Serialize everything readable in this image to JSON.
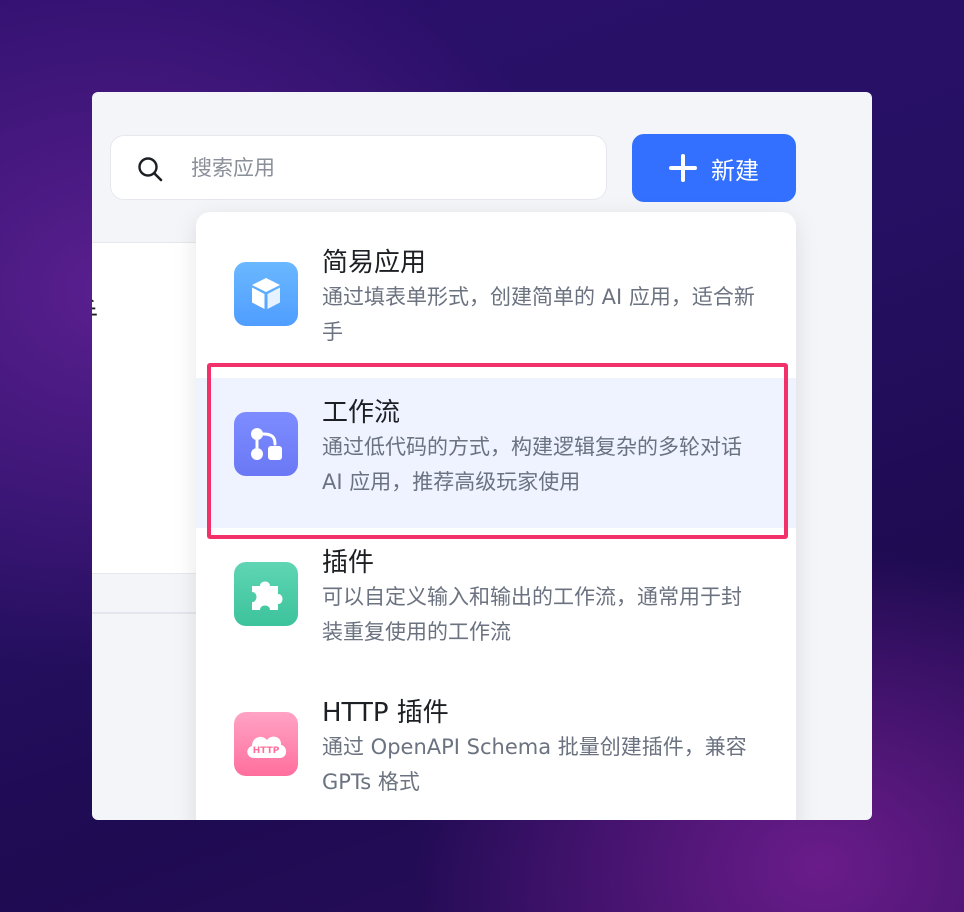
{
  "search": {
    "placeholder": "搜索应用"
  },
  "toolbar": {
    "new_label": "新建"
  },
  "background_card": {
    "text_fragment": "手"
  },
  "menu": {
    "items": [
      {
        "title": "简易应用",
        "description": "通过填表单形式，创建简单的 AI 应用，适合新手",
        "icon": "cube-icon",
        "color": "#5aaeff"
      },
      {
        "title": "工作流",
        "description": "通过低代码的方式，构建逻辑复杂的多轮对话 AI 应用，推荐高级玩家使用",
        "icon": "workflow-icon",
        "color": "#7584fb",
        "selected": true
      },
      {
        "title": "插件",
        "description": "可以自定义输入和输出的工作流，通常用于封装重复使用的工作流",
        "icon": "puzzle-icon",
        "color": "#4ccba8"
      },
      {
        "title": "HTTP 插件",
        "description": "通过 OpenAPI Schema 批量创建插件，兼容 GPTs 格式",
        "icon": "http-cloud-icon",
        "icon_text": "HTTP",
        "color": "#ff88b0"
      }
    ]
  },
  "colors": {
    "accent": "#3370ff",
    "highlight": "#f2306a"
  }
}
